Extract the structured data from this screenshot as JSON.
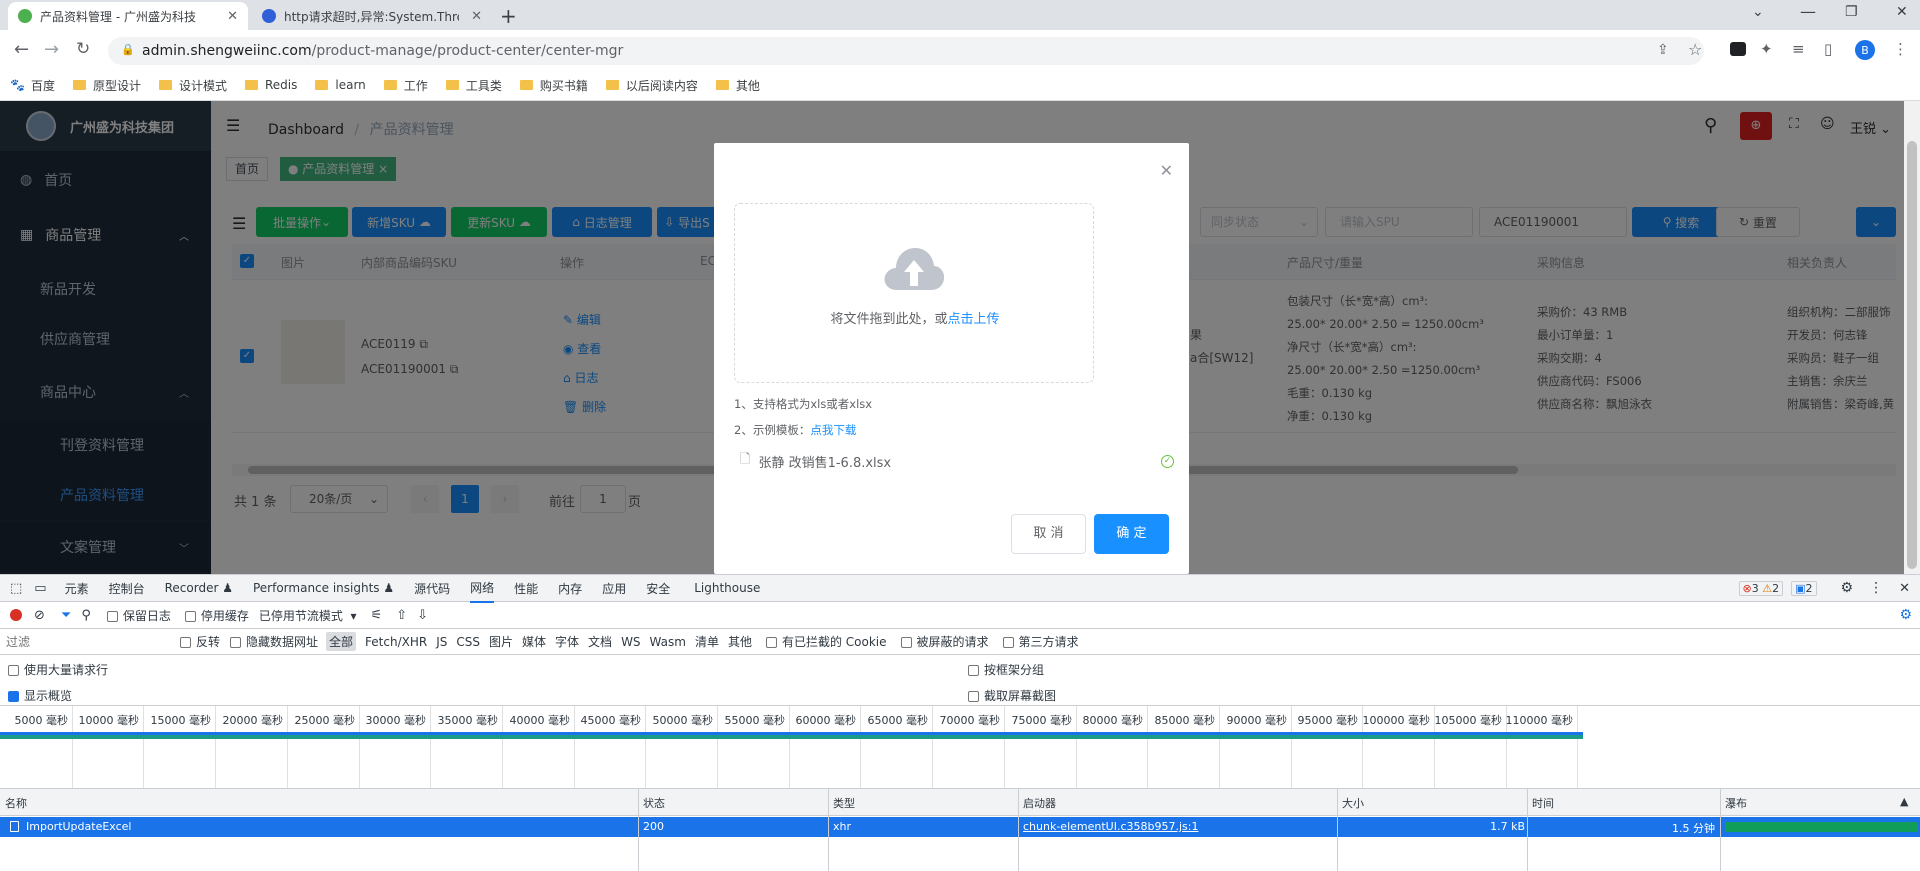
{
  "browser": {
    "tabs": [
      {
        "title": "产品资料管理 - 广州盛为科技"
      },
      {
        "title": "http请求超时,异常:System.Thre"
      }
    ],
    "url_host": "admin.shengweiinc.com",
    "url_path": "/product-manage/product-center/center-mgr",
    "bookmarks": [
      "百度",
      "原型设计",
      "设计模式",
      "Redis",
      "learn",
      "工作",
      "工具类",
      "购买书籍",
      "以后阅读内容",
      "其他"
    ],
    "profile": "B"
  },
  "app": {
    "company": "广州盛为科技集团",
    "menu": {
      "home": "首页",
      "product_mgmt": "商品管理",
      "new_product": "新品开发",
      "supplier": "供应商管理",
      "product_center": "商品中心",
      "listing": "刊登资料管理",
      "product_info": "产品资料管理",
      "copywriting": "文案管理"
    },
    "breadcrumb": {
      "root": "Dashboard",
      "sep": "/",
      "current": "产品资料管理"
    },
    "header_user": "王锐",
    "tags": {
      "home": "首页",
      "current": "产品资料管理",
      "close": "×"
    },
    "toolbar": {
      "batch": "批量操作",
      "add_sku": "新增SKU",
      "update_sku": "更新SKU",
      "log_mgmt": "日志管理",
      "export": "导出S",
      "sync_status": "同步状态",
      "spu_placeholder": "请输入SPU",
      "sku_value": "ACE01190001",
      "search": "搜索",
      "reset": "重置"
    },
    "table": {
      "headers": {
        "image": "图片",
        "sku": "内部商品编码SKU",
        "op": "操作",
        "ec": "EC",
        "size": "产品尺寸/重量",
        "purchase": "采购信息",
        "owner": "相关负责人"
      },
      "row": {
        "sku1": "ACE0119",
        "sku2": "ACE01190001",
        "ops": [
          "编辑",
          "查看",
          "日志",
          "删除"
        ],
        "col_partial": [
          "果",
          "a合[SW12]"
        ],
        "size": [
          "包装尺寸（长*宽*高）cm³:",
          "25.00* 20.00* 2.50 = 1250.00cm³",
          "净尺寸（长*宽*高）cm³:",
          "25.00* 20.00* 2.50 =1250.00cm³",
          "毛重：0.130 kg",
          "净重：0.130 kg"
        ],
        "purchase": [
          "采购价：43 RMB",
          "最小订单量：1",
          "采购交期：4",
          "供应商代码：FS006",
          "供应商名称：飘旭泳衣"
        ],
        "owner": [
          "组织机构：二部服饰",
          "开发员：何志锋",
          "采购员：鞋子一组",
          "主销售：余庆兰",
          "附属销售：梁奇峰,黄"
        ]
      }
    },
    "pagination": {
      "total": "共 1 条",
      "page_size": "20条/页",
      "page": "1",
      "goto_prefix": "前往",
      "goto_value": "1",
      "goto_suffix": "页"
    }
  },
  "modal": {
    "drop_text": "将文件拖到此处，或",
    "drop_link": "点击上传",
    "tip1": "1、支持格式为xls或者xlsx",
    "tip2_prefix": "2、示例模板：",
    "tip2_link": "点我下载",
    "file_name": "张静 改销售1-6.8.xlsx",
    "cancel": "取 消",
    "confirm": "确 定"
  },
  "devtools": {
    "tabs": [
      "元素",
      "控制台",
      "Recorder",
      "Performance insights",
      "源代码",
      "网络",
      "性能",
      "内存",
      "应用",
      "安全",
      "Lighthouse"
    ],
    "active_tab": "网络",
    "errors": "3",
    "warnings": "2",
    "messages": "2",
    "net_toolbar": {
      "preserve_log": "保留日志",
      "disable_cache": "停用缓存",
      "throttle": "已停用节流模式"
    },
    "filter": {
      "placeholder": "过滤",
      "invert": "反转",
      "hide_data": "隐藏数据网址",
      "types": [
        "全部",
        "Fetch/XHR",
        "JS",
        "CSS",
        "图片",
        "媒体",
        "字体",
        "文档",
        "WS",
        "Wasm",
        "清单",
        "其他"
      ],
      "blocked_cookies": "有已拦截的 Cookie",
      "blocked_req": "被屏蔽的请求",
      "third_party": "第三方请求"
    },
    "options": {
      "big_rows": "使用大量请求行",
      "group_frame": "按框架分组",
      "overview": "显示概览",
      "screenshots": "截取屏幕截图"
    },
    "timeline": [
      "5000 毫秒",
      "10000 毫秒",
      "15000 毫秒",
      "20000 毫秒",
      "25000 毫秒",
      "30000 毫秒",
      "35000 毫秒",
      "40000 毫秒",
      "45000 毫秒",
      "50000 毫秒",
      "55000 毫秒",
      "60000 毫秒",
      "65000 毫秒",
      "70000 毫秒",
      "75000 毫秒",
      "80000 毫秒",
      "85000 毫秒",
      "90000 毫秒",
      "95000 毫秒",
      "100000 毫秒",
      "105000 毫秒",
      "110000 毫秒"
    ],
    "columns": [
      "名称",
      "状态",
      "类型",
      "启动器",
      "大小",
      "时间",
      "瀑布"
    ],
    "request": {
      "name": "ImportUpdateExcel",
      "status": "200",
      "type": "xhr",
      "initiator": "chunk-elementUI.c358b957.js:1",
      "size": "1.7 kB",
      "time": "1.5 分钟"
    }
  },
  "colors": {
    "accent": "#1890ff",
    "green": "#13ce66",
    "sidebar": "#1f2d3d",
    "devtools_select": "#1a73e8"
  }
}
